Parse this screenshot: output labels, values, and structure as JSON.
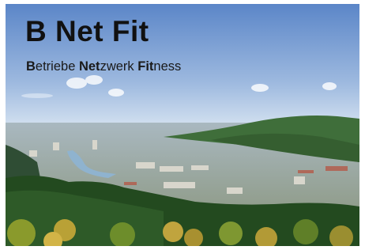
{
  "title": "B Net Fit",
  "subtitle": {
    "parts": [
      {
        "text": "B",
        "bold": true
      },
      {
        "text": "etriebe ",
        "bold": false
      },
      {
        "text": "Net",
        "bold": true
      },
      {
        "text": "zwerk ",
        "bold": false
      },
      {
        "text": "Fit",
        "bold": true
      },
      {
        "text": "ness",
        "bold": false
      }
    ]
  },
  "colors": {
    "sky_top": "#5b86c8",
    "sky_bottom": "#dde8f3",
    "hills": "#3f6e3a",
    "forest": "#234a1f",
    "autumn_trees": "#b9a136",
    "river": "#8fb3cf"
  }
}
